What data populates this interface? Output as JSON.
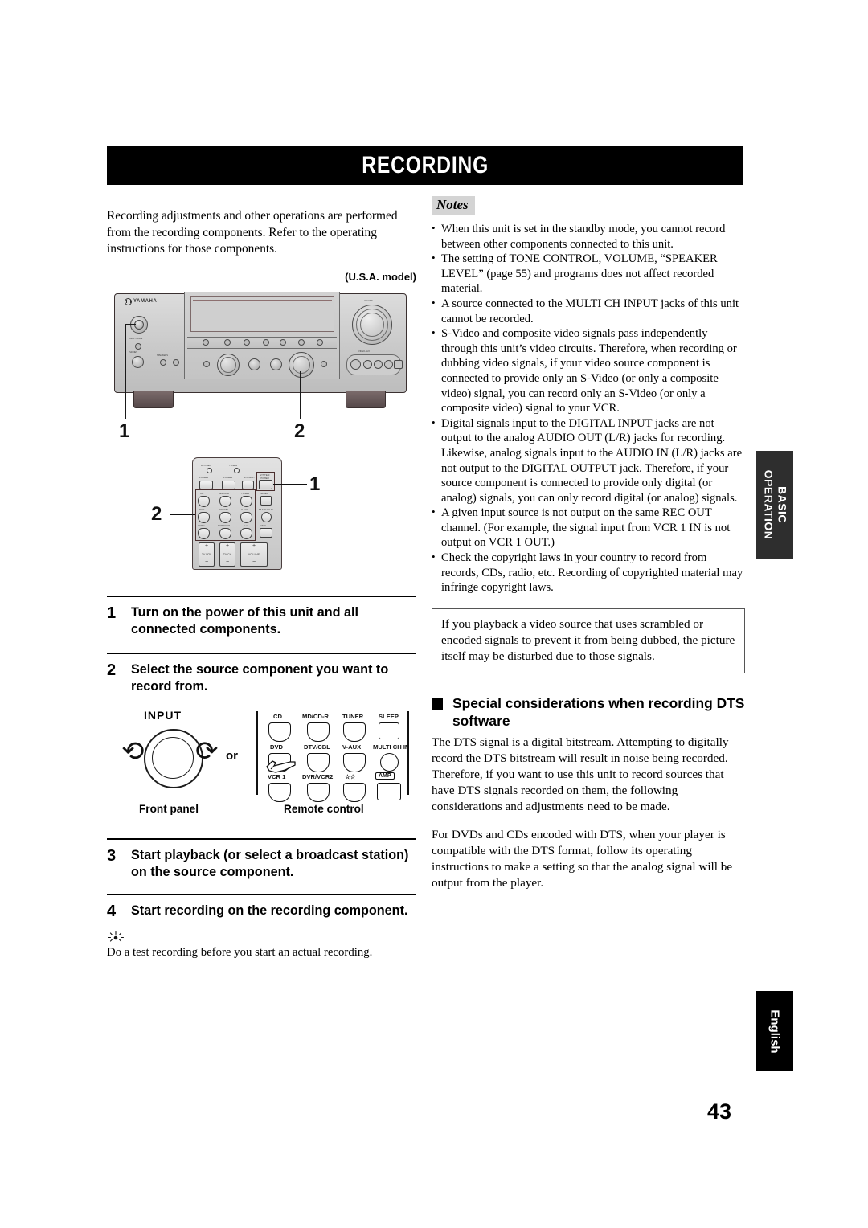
{
  "header": {
    "title": "RECORDING"
  },
  "left": {
    "intro": "Recording adjustments and other operations are performed from the recording components. Refer to the operating instructions for those components.",
    "usa_model_label": "(U.S.A. model)",
    "receiver_callouts": [
      "1",
      "2"
    ],
    "remote_callouts": [
      "1",
      "2"
    ],
    "receiver_brand": "YAMAHA",
    "steps": [
      {
        "num": "1",
        "text": "Turn on the power of this unit and all connected components."
      },
      {
        "num": "2",
        "text": "Select the source component you want to record from."
      },
      {
        "num": "3",
        "text": "Start playback (or select a broadcast station) on the source component."
      },
      {
        "num": "4",
        "text": "Start recording on the recording component."
      }
    ],
    "input_figure": {
      "input_label": "INPUT",
      "or_label": "or",
      "front_panel_caption": "Front panel",
      "remote_control_caption": "Remote control",
      "remote_buttons": [
        [
          "CD",
          "MD/CD-R",
          "TUNER",
          "SLEEP"
        ],
        [
          "DVD",
          "DTV/CBL",
          "V-AUX",
          "MULTI CH IN"
        ],
        [
          "VCR 1",
          "DVR/VCR2",
          "☆☆",
          "AMP"
        ]
      ]
    },
    "tip_text": "Do a test recording before you start an actual recording."
  },
  "right": {
    "notes_label": "Notes",
    "notes": [
      "When this unit is set in the standby mode, you cannot record between other components connected to this unit.",
      "The setting of TONE CONTROL, VOLUME, “SPEAKER LEVEL” (page 55) and programs does not affect recorded material.",
      "A source connected to the MULTI CH INPUT jacks of this unit cannot be recorded.",
      "S-Video and composite video signals pass independently through this unit’s video circuits. Therefore, when recording or dubbing video signals, if your video source component is connected to provide only an S-Video (or only a composite video) signal, you can record only an S-Video (or only a composite video) signal to your VCR.",
      "Digital signals input to the DIGITAL INPUT jacks are not output to the analog AUDIO OUT (L/R) jacks for recording. Likewise, analog signals input to the AUDIO IN (L/R) jacks are not output to the DIGITAL OUTPUT jack. Therefore, if your source component is connected to provide only digital (or analog) signals, you can only record digital (or analog) signals.",
      "A given input source is not output on the same REC OUT channel. (For example, the signal input from VCR 1 IN is not output on VCR 1 OUT.)",
      "Check the copyright laws in your country to record from records, CDs, radio, etc. Recording of copyrighted material may infringe copyright laws."
    ],
    "warning": "If you playback a video source that uses scrambled or encoded signals to prevent it from being dubbed, the picture itself may be disturbed due to those signals.",
    "dts_heading": "Special considerations when recording DTS software",
    "dts_paragraphs": [
      "The DTS signal is a digital bitstream. Attempting to digitally record the DTS bitstream will result in noise being recorded. Therefore, if you want to use this unit to record sources that have DTS signals recorded on them, the following considerations and adjustments need to be made.",
      "For DVDs and CDs encoded with DTS, when your player is compatible with the DTS format, follow its operating instructions to make a setting so that the analog signal will be output from the player."
    ]
  },
  "tabs": {
    "basic_operation": "BASIC\nOPERATION",
    "basic_operation_line1": "BASIC",
    "basic_operation_line2": "OPERATION",
    "english": "English"
  },
  "footer": {
    "page_number": "43"
  },
  "colors": {
    "title_bar_bg": "#000000",
    "tab_basic_bg": "#2e2e2e",
    "tab_english_bg": "#000000",
    "notes_label_bg": "#d4d4d4"
  }
}
